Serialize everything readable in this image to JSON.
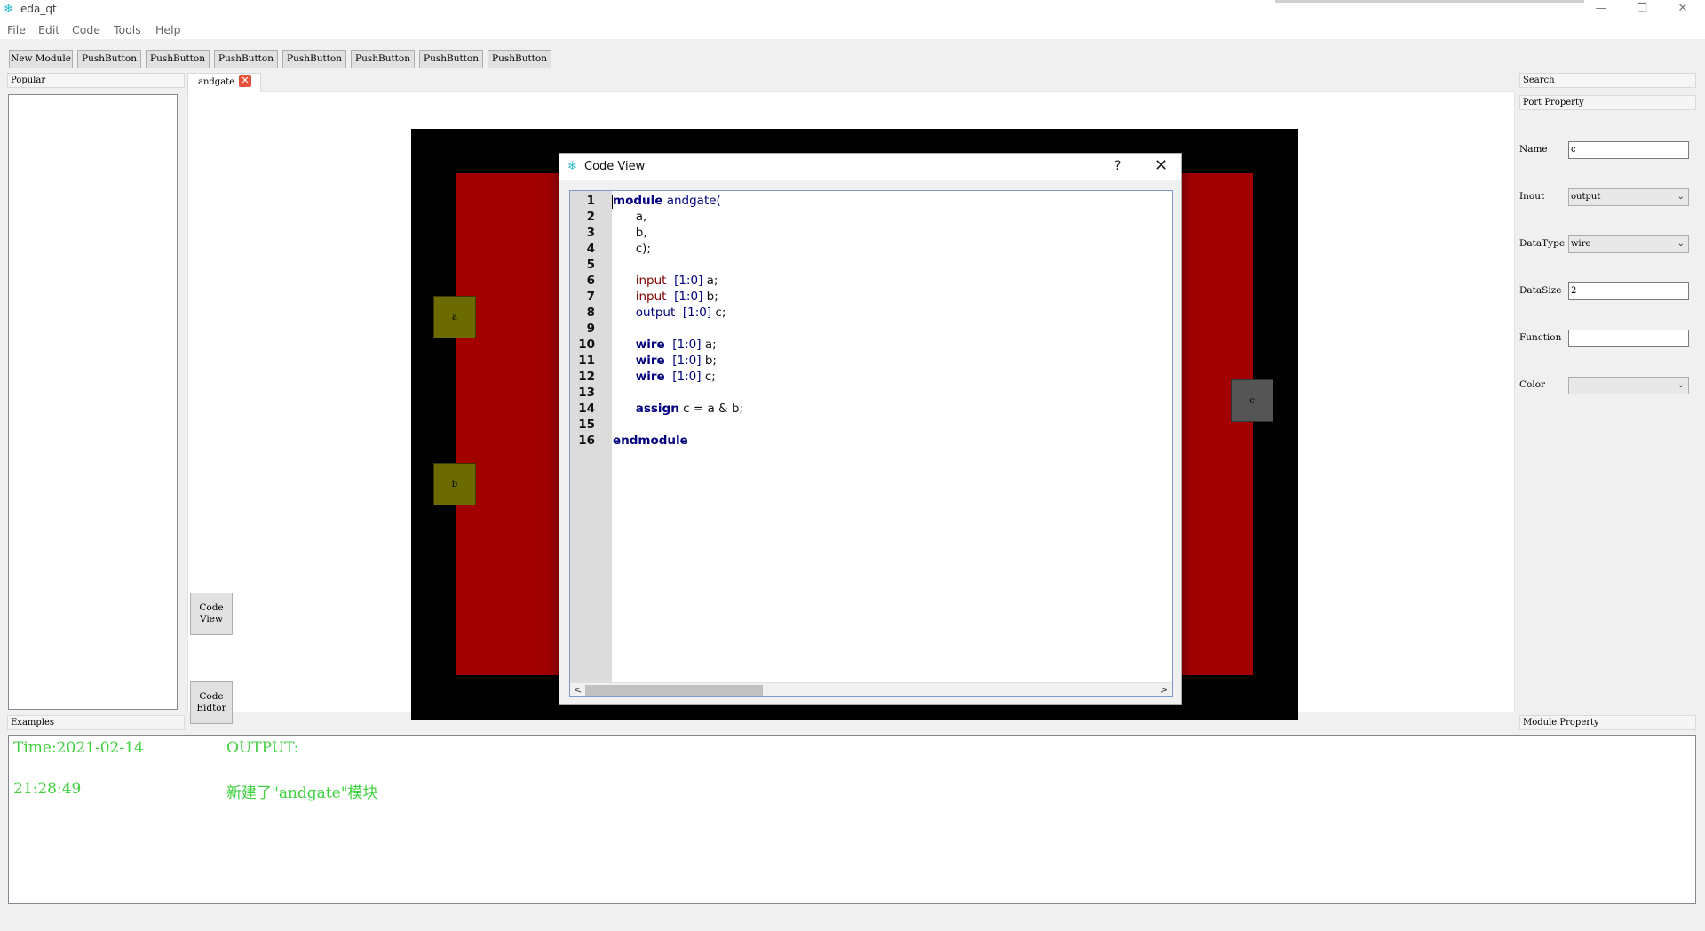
{
  "window": {
    "title": "eda_qt",
    "minimize": "—",
    "restore": "❐",
    "close": "✕"
  },
  "menu": [
    "File",
    "Edit",
    "Code",
    "Tools",
    "Help"
  ],
  "toolbar": [
    "New Module",
    "PushButton",
    "PushButton",
    "PushButton",
    "PushButton",
    "PushButton",
    "PushButton",
    "PushButton"
  ],
  "left_dock": {
    "popular_title": "Popular",
    "examples_title": "Examples"
  },
  "tab": {
    "label": "andgate",
    "close": "✕"
  },
  "side_buttons": {
    "code_view": "Code\nView",
    "code_editor": "Code\nEidtor"
  },
  "canvas": {
    "ports": {
      "a": "a",
      "b": "b",
      "c": "c"
    }
  },
  "dialog": {
    "title": "Code View",
    "help": "?",
    "close": "✕",
    "line_numbers": [
      "1",
      "2",
      "3",
      "4",
      "5",
      "6",
      "7",
      "8",
      "9",
      "10",
      "11",
      "12",
      "13",
      "14",
      "15",
      "16"
    ],
    "code": {
      "l1_kw": "module",
      "l1_rest": " andgate(",
      "l2": "      a,",
      "l3": "      b,",
      "l4": "      c);",
      "l6_kw": "input",
      "l6_rng": "[1:0]",
      "l6_id": " a;",
      "l7_kw": "input",
      "l7_rng": "[1:0]",
      "l7_id": " b;",
      "l8_kw": "output",
      "l8_rng": "[1:0]",
      "l8_id": " c;",
      "l10_kw": "wire",
      "l10_rng": "[1:0]",
      "l10_id": " a;",
      "l11_kw": "wire",
      "l11_rng": "[1:0]",
      "l11_id": " b;",
      "l12_kw": "wire",
      "l12_rng": "[1:0]",
      "l12_id": " c;",
      "l14_kw": "assign",
      "l14_rest": " c = a & b;",
      "l16_kw": "endmodule"
    },
    "scroll_left": "<",
    "scroll_right": ">"
  },
  "right_dock": {
    "search_title": "Search",
    "port_property_title": "Port Property",
    "module_property_title": "Module Property",
    "fields": {
      "name_label": "Name",
      "name_value": "c",
      "inout_label": "Inout",
      "inout_value": "output",
      "datatype_label": "DataType",
      "datatype_value": "wire",
      "datasize_label": "DataSize",
      "datasize_value": "2",
      "function_label": "Function",
      "function_value": "",
      "color_label": "Color",
      "color_value": ""
    },
    "combo_arrow": "⌄"
  },
  "output": {
    "time_label": "Time:2021-02-14",
    "time_value": "21:28:49",
    "output_label": "OUTPUT:",
    "message": "新建了\"andgate\"模块"
  },
  "colors": {
    "canvas_bg": "#000000",
    "module_body": "#a20000",
    "input_port": "#6b6b00",
    "output_port": "#555555",
    "output_text": "#40d040"
  }
}
